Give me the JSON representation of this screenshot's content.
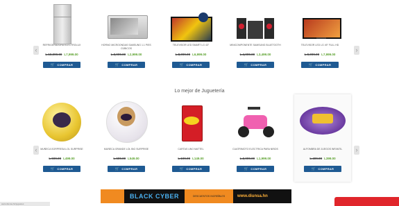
{
  "buy_label": "COMPRAR",
  "section_title": "Lo mejor de Juguetería",
  "appliances": [
    {
      "name": "REFRIGERADORA ELECTROLUX",
      "old_price": "L.10,999.00",
      "new_price": "L7,999.00",
      "icon": "refrigerator-icon"
    },
    {
      "name": "HORNO MICROONDAS SAMSUNG 1.1 PIES CÚBICOS",
      "old_price": "L.3,999.00",
      "new_price": "L2,999.00",
      "icon": "microwave-icon"
    },
    {
      "name": "TELEVISOR LED SMART LG 43\"",
      "old_price": "L.8,999.00",
      "new_price": "L6,999.00",
      "icon": "television-icon"
    },
    {
      "name": "MINICOMPONENTE SAMSUNG BLUETOOTH",
      "old_price": "L.4,999.00",
      "new_price": "L3,499.00",
      "icon": "stereo-icon"
    },
    {
      "name": "TELEVISOR LED LG 49\" FULL HD",
      "old_price": "L.9,999.00",
      "new_price": "L7,999.00",
      "icon": "flat-tv-icon"
    }
  ],
  "toys": [
    {
      "name": "MUÑECA SORPRESA LOL SURPRISE",
      "old_price": "L.599.00",
      "new_price": "L499.00",
      "icon": "lol-ball-icon"
    },
    {
      "name": "MUÑECA GRANDE LOL BIG SURPRISE",
      "old_price": "L.699.00",
      "new_price": "L549.00",
      "icon": "lol-doll-icon"
    },
    {
      "name": "CARTAS UNO MATTEL",
      "old_price": "L.199.00",
      "new_price": "L149.00",
      "icon": "uno-cards-icon"
    },
    {
      "name": "CUATRIMOTO ELÉCTRICA PARA NIÑOS",
      "old_price": "L.2,999.00",
      "new_price": "L1,999.00",
      "icon": "ride-on-atv-icon"
    },
    {
      "name": "ALFOMBRA DE JUEGOS INFANTIL",
      "old_price": "L.499.00",
      "new_price": "L399.00",
      "icon": "play-mat-icon"
    }
  ],
  "banner": {
    "headline": "BLACK CYBER",
    "middle": "DESCUENTOS INCREÍBLES",
    "url": "www.diunsa.hn"
  },
  "footer": {
    "tab": "www.diunsa.hn/juguetes"
  },
  "colors": {
    "buy_button": "#1e5a93",
    "sale_price": "#5aa02c",
    "chat_bar": "#e0262b",
    "banner_accent": "#f08a20"
  }
}
